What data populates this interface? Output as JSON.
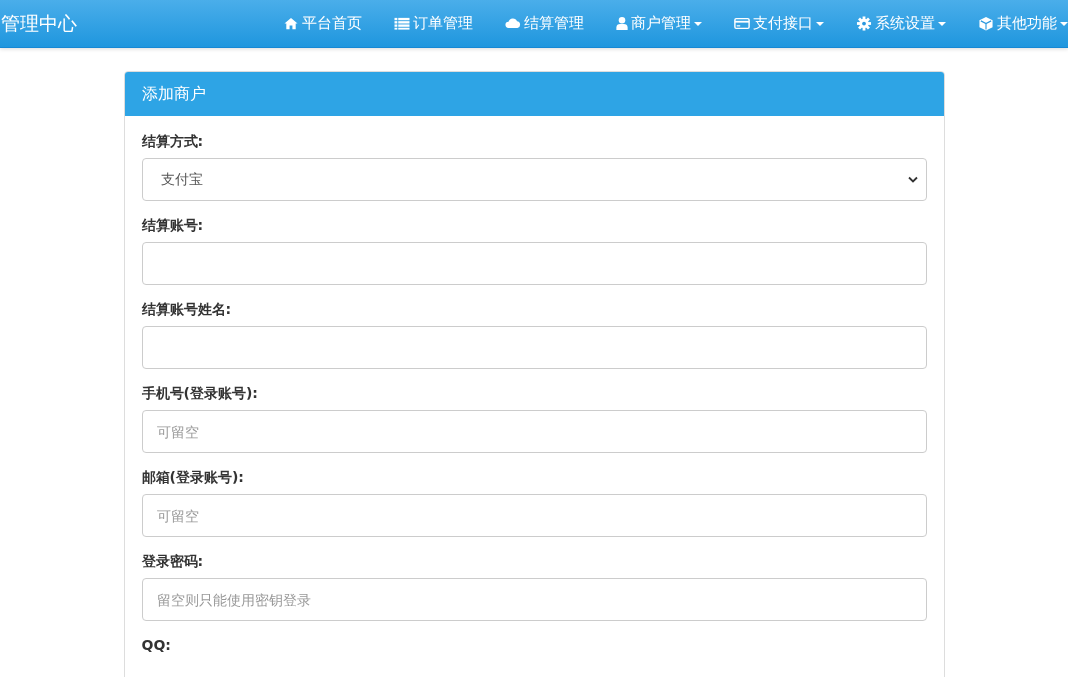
{
  "navbar": {
    "brand": "管理中心",
    "items": [
      {
        "label": "平台首页",
        "dropdown": false
      },
      {
        "label": "订单管理",
        "dropdown": false
      },
      {
        "label": "结算管理",
        "dropdown": false
      },
      {
        "label": "商户管理",
        "dropdown": true
      },
      {
        "label": "支付接口",
        "dropdown": true
      },
      {
        "label": "系统设置",
        "dropdown": true
      },
      {
        "label": "其他功能",
        "dropdown": true
      }
    ]
  },
  "panel": {
    "title": "添加商户",
    "fields": [
      {
        "kind": "select",
        "label": "结算方式:",
        "value": "支付宝"
      },
      {
        "kind": "input",
        "label": "结算账号:"
      },
      {
        "kind": "input",
        "label": "结算账号姓名:"
      },
      {
        "kind": "input",
        "label": "手机号(登录账号):",
        "placeholder": "可留空"
      },
      {
        "kind": "input",
        "label": "邮箱(登录账号):",
        "placeholder": "可留空"
      },
      {
        "kind": "input",
        "label": "登录密码:",
        "placeholder": "留空则只能使用密钥登录"
      },
      {
        "kind": "label",
        "label": "QQ:"
      }
    ]
  }
}
